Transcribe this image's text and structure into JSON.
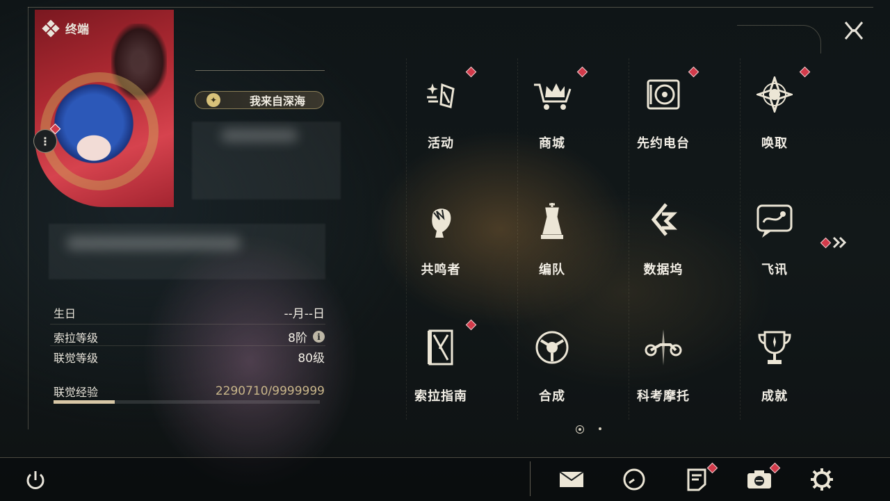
{
  "header": {
    "title": "终端"
  },
  "profile": {
    "player_name": "我来自深海",
    "stats": [
      {
        "label": "生日",
        "value": "--月--日"
      },
      {
        "label": "索拉等级",
        "value": "8阶"
      },
      {
        "label": "联觉等级",
        "value": "80级"
      }
    ],
    "exp": {
      "label": "联觉经验",
      "value": "2290710/9999999",
      "progress": 0.229
    }
  },
  "menu": {
    "items": [
      {
        "label": "活动",
        "icon": "sparkle-flag-icon",
        "notify": true
      },
      {
        "label": "商城",
        "icon": "crown-cart-icon",
        "notify": true
      },
      {
        "label": "先约电台",
        "icon": "vinyl-radio-icon",
        "notify": true
      },
      {
        "label": "唤取",
        "icon": "star-compass-icon",
        "notify": true
      },
      {
        "label": "共鸣者",
        "icon": "character-head-icon",
        "notify": false
      },
      {
        "label": "编队",
        "icon": "chess-team-icon",
        "notify": false
      },
      {
        "label": "数据坞",
        "icon": "data-dock-icon",
        "notify": false
      },
      {
        "label": "飞讯",
        "icon": "chat-bubble-icon",
        "notify": false
      },
      {
        "label": "索拉指南",
        "icon": "guide-book-icon",
        "notify": true
      },
      {
        "label": "合成",
        "icon": "synthesis-icon",
        "notify": false
      },
      {
        "label": "科考摩托",
        "icon": "motorbike-icon",
        "notify": false
      },
      {
        "label": "成就",
        "icon": "trophy-icon",
        "notify": false
      }
    ],
    "page_current": 1,
    "page_total": 2
  },
  "bottom_bar": {
    "buttons": [
      "power-icon",
      "mail-icon",
      "clock-icon",
      "notice-icon",
      "camera-icon",
      "settings-gear-icon"
    ]
  },
  "colors": {
    "notify_red": "#d23a4a",
    "accent_gold": "#c9b68a"
  }
}
